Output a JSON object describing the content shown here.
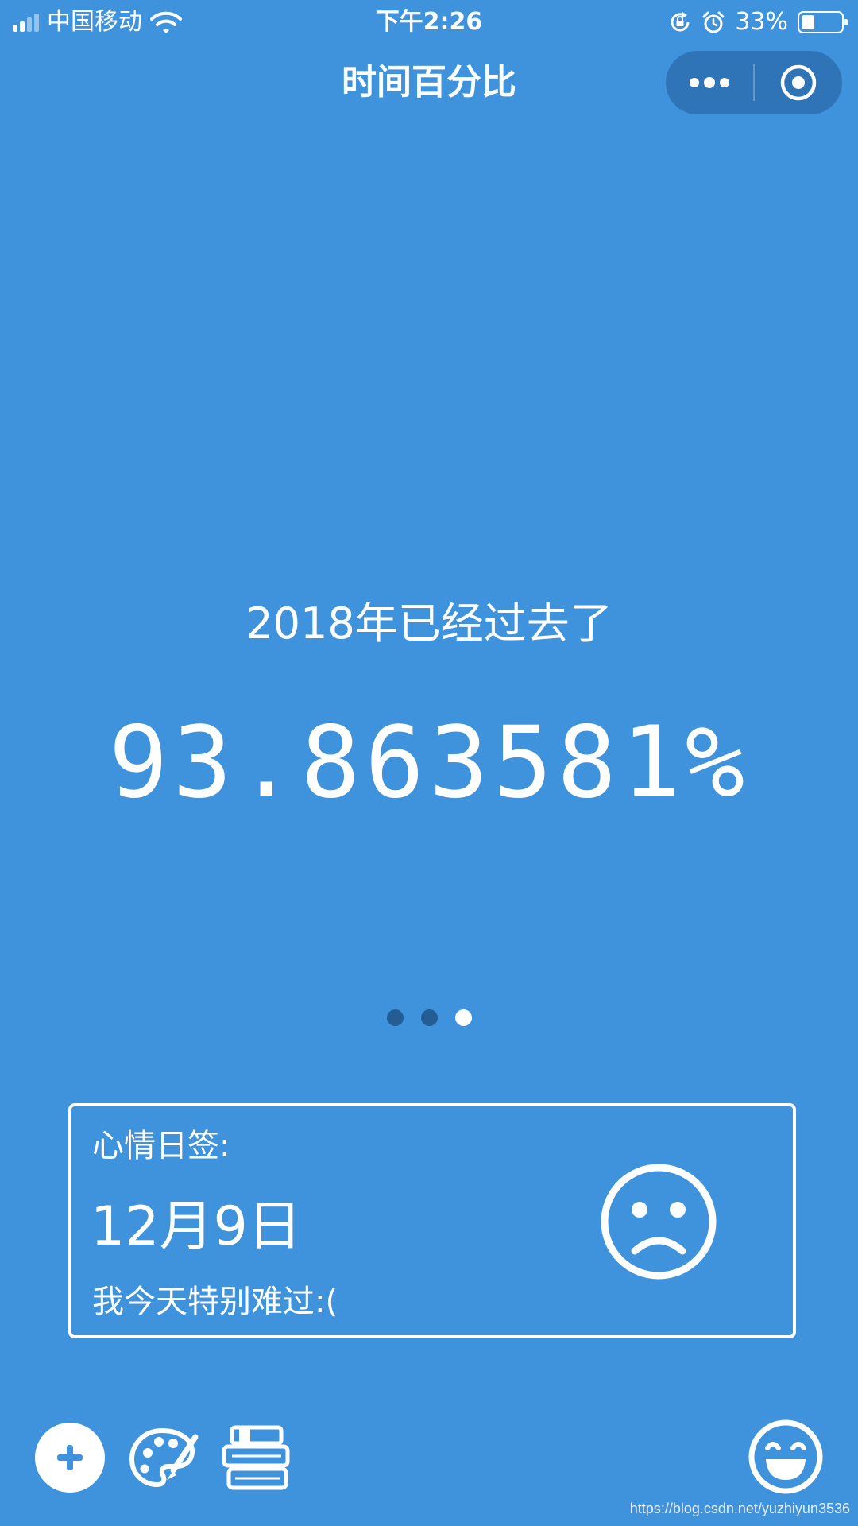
{
  "status_bar": {
    "carrier": "中国移动",
    "time": "下午2:26",
    "battery_percent": "33%",
    "battery_level": 0.33,
    "icons": [
      "signal-icon",
      "wifi-icon",
      "rotation-lock-icon",
      "alarm-icon",
      "battery-icon"
    ]
  },
  "nav": {
    "title": "时间百分比",
    "capsule_icons": [
      "more-icon",
      "close-target-icon"
    ]
  },
  "progress": {
    "label": "2018年已经过去了",
    "percent": "93.863581%"
  },
  "pager": {
    "count": 3,
    "active_index": 2
  },
  "mood": {
    "heading": "心情日签:",
    "date": "12月9日",
    "text": "我今天特别难过:(",
    "icon": "sad-face-icon"
  },
  "toolbar": {
    "icons": [
      "add-icon",
      "palette-icon",
      "book-icon",
      "happy-face-icon"
    ]
  },
  "watermark": "https://blog.csdn.net/yuzhiyun3536",
  "colors": {
    "background": "#3f93dc",
    "foreground": "#ffffff",
    "dot_inactive": "#235d93",
    "capsule": "#2a6aa8"
  }
}
